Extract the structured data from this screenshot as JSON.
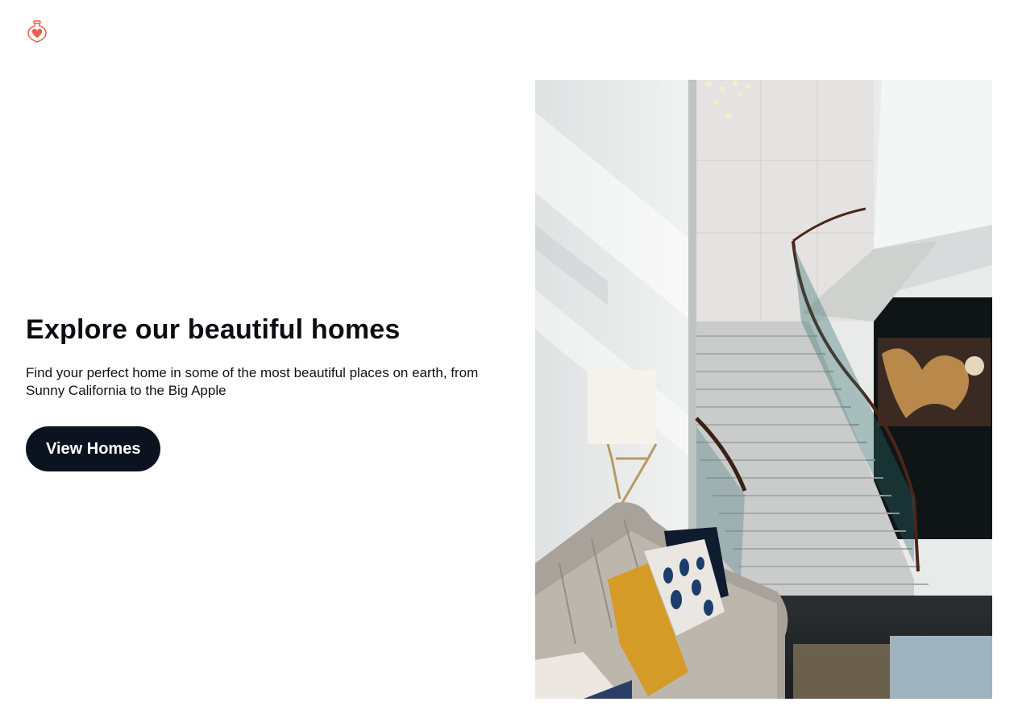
{
  "header": {
    "logo_icon": "heart-flask-logo",
    "logo_color": "#e8604c"
  },
  "hero": {
    "title": "Explore our beautiful homes",
    "subtitle": "Find your perfect home in some of the most beautiful places on earth, from Sunny California to the Big Apple",
    "cta_label": "View Homes",
    "cta_color": "#0b1320"
  },
  "photo": {
    "subject": "staircase-lobby-photo"
  }
}
